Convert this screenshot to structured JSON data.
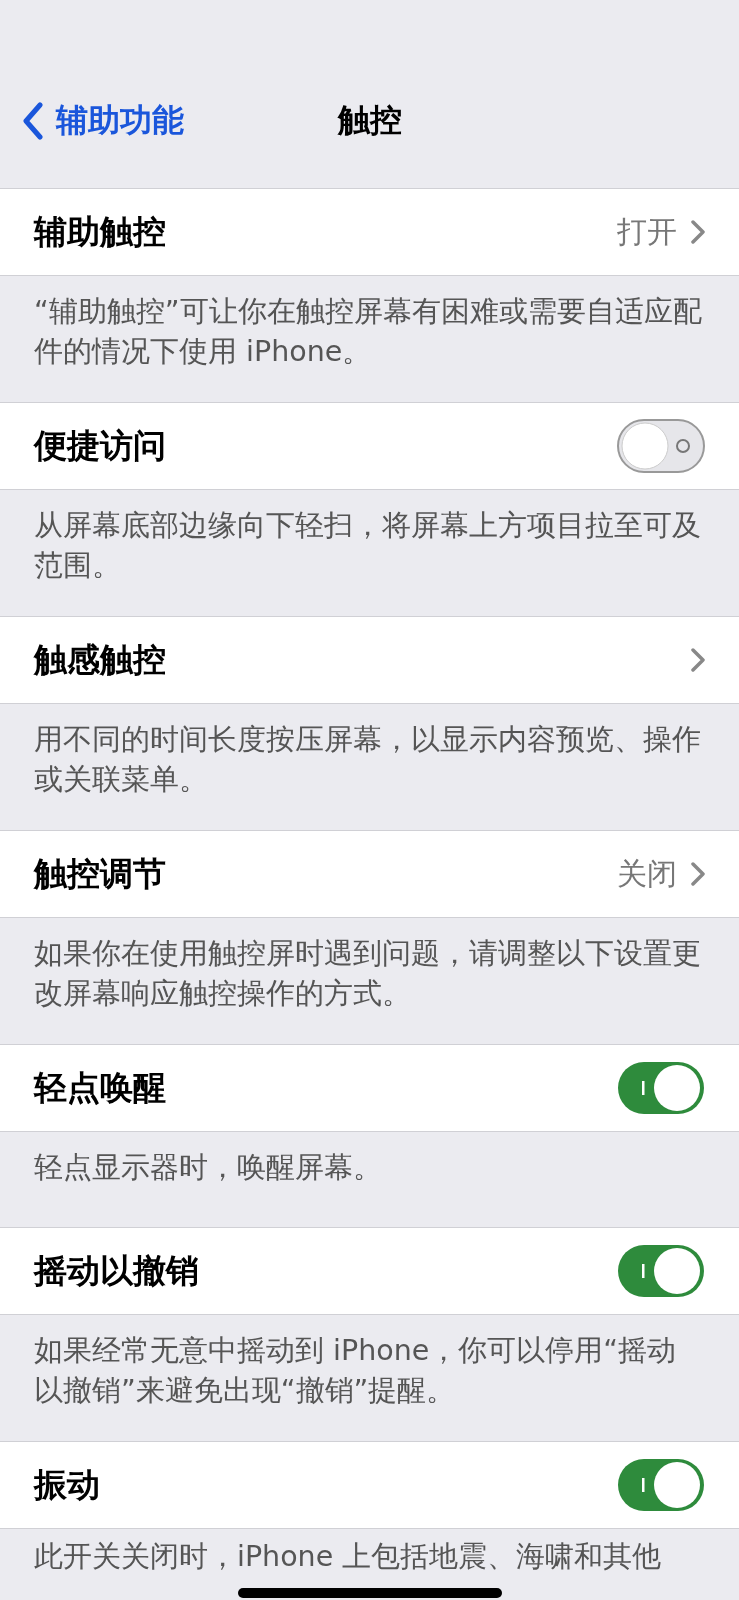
{
  "nav": {
    "back": "辅助功能",
    "title": "触控"
  },
  "sections": [
    {
      "label": "辅助触控",
      "kind": "link",
      "value": "打开",
      "footer": "“辅助触控”可让你在触控屏幕有困难或需要自适应配件的情况下使用 iPhone。"
    },
    {
      "label": "便捷访问",
      "kind": "toggle",
      "on": false,
      "footer": "从屏幕底部边缘向下轻扫，将屏幕上方项目拉至可及范围。"
    },
    {
      "label": "触感触控",
      "kind": "link",
      "footer": "用不同的时间长度按压屏幕，以显示内容预览、操作或关联菜单。"
    },
    {
      "label": "触控调节",
      "kind": "link",
      "value": "关闭",
      "footer": "如果你在使用触控屏时遇到问题，请调整以下设置更改屏幕响应触控操作的方式。"
    },
    {
      "label": "轻点唤醒",
      "kind": "toggle",
      "on": true,
      "footer": "轻点显示器时，唤醒屏幕。"
    },
    {
      "label": "摇动以撤销",
      "kind": "toggle",
      "on": true,
      "footer": "如果经常无意中摇动到 iPhone，你可以停用“摇动以撤销”来避免出现“撤销”提醒。"
    },
    {
      "label": "振动",
      "kind": "toggle",
      "on": true,
      "footer": "此开关关闭时，iPhone 上包括地震、海啸和其他"
    }
  ]
}
